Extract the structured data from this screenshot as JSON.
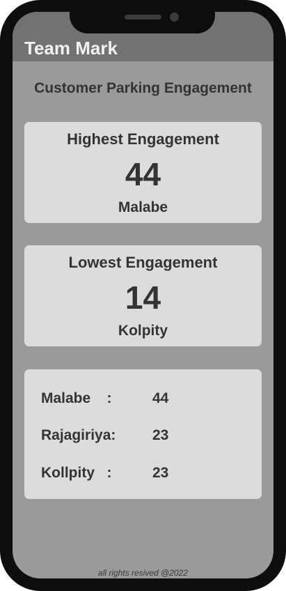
{
  "header": {
    "title": "Team Mark"
  },
  "page": {
    "title": "Customer Parking Engagement"
  },
  "highest": {
    "heading": "Highest Engagement",
    "value": "44",
    "location": "Malabe"
  },
  "lowest": {
    "heading": "Lowest Engagement",
    "value": "14",
    "location": "Kolpity"
  },
  "list": [
    {
      "name": "Malabe    :",
      "value": "44"
    },
    {
      "name": "Rajagiriya:",
      "value": "23"
    },
    {
      "name": "Kollpity   :",
      "value": "23"
    }
  ],
  "footer": {
    "text": "all rights resived @2022"
  },
  "colors": {
    "frame": "#0d0d0d",
    "screen_background": "#9a9a9a",
    "header_background": "#727272",
    "card_background": "#dcdcdc",
    "text": "#333333"
  }
}
